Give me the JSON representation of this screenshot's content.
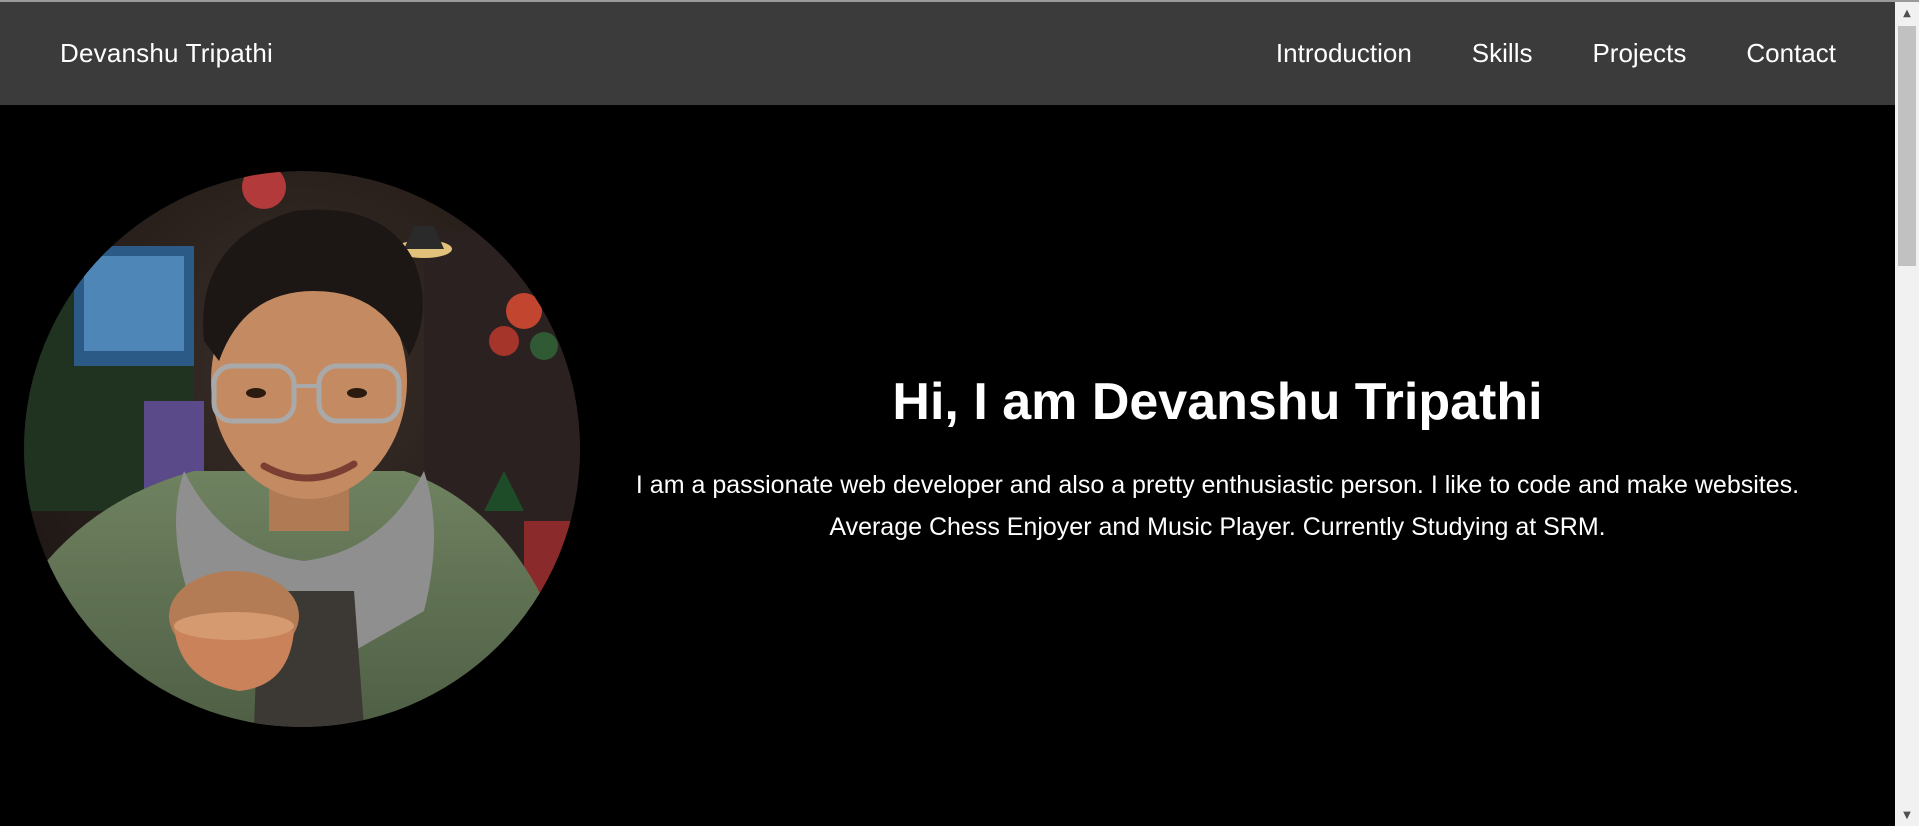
{
  "navbar": {
    "brand": "Devanshu Tripathi",
    "links": [
      {
        "label": "Introduction"
      },
      {
        "label": "Skills"
      },
      {
        "label": "Projects"
      },
      {
        "label": "Contact"
      }
    ]
  },
  "hero": {
    "heading": "Hi, I am Devanshu Tripathi",
    "description": "I am a passionate web developer and also a pretty enthusiastic person. I like to code and make websites. Average Chess Enjoyer and Music Player. Currently Studying at SRM.",
    "avatar_alt": "profile-photo"
  },
  "colors": {
    "navbar_bg": "#3b3b3b",
    "page_bg": "#000000",
    "text": "#ffffff"
  },
  "icons": {
    "scroll_up": "scroll-up-arrow-icon",
    "scroll_down": "scroll-down-arrow-icon"
  }
}
